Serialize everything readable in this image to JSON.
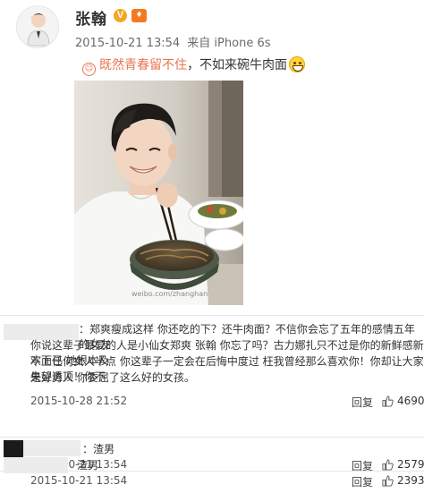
{
  "post": {
    "username": "张翰",
    "verified_icon": "v-verified-icon",
    "vip_icon": "vip-icon",
    "timestamp": "2015-10-21 13:54",
    "source": "来自 iPhone 6s",
    "topic": "既然青春留不住",
    "text": "，不如来碗牛肉面",
    "emoji": "grin-emoji",
    "watermark": "weibo.com/zhanghan",
    "image": "photo of a smiling young man eating a bowl of beef noodles"
  },
  "comments": [
    {
      "lines": [
        "：郑爽瘦成这样 你还吃的下？还牛肉面？不信你会忘了五年的感情五年的女友",
        "你说这辈子最爱的人是小仙女郑爽 张翰 你忘了吗？古力娜扎只不过是你的新鲜感新欢而已 她根本及",
        "不上任何女人半点 你这辈子一定会在后悔中度过 枉我曾经那么喜欢你！你却让大家失望透顶！你不",
        "是好男人 你委屈了这么好的女孩。"
      ],
      "date": "2015-10-28 21:52",
      "reply": "回复",
      "likes": "4690"
    },
    {
      "lines": [
        "：渣男"
      ],
      "date": "2015-10-21 13:54",
      "reply": "回复",
      "likes": "2579"
    },
    {
      "lines": [
        "渣男"
      ],
      "date": "2015-10-21 13:54",
      "reply": "回复",
      "likes": "2393"
    }
  ],
  "colors": {
    "accent": "#eb7350",
    "vip": "#f47a20",
    "verified": "#f5a623"
  }
}
